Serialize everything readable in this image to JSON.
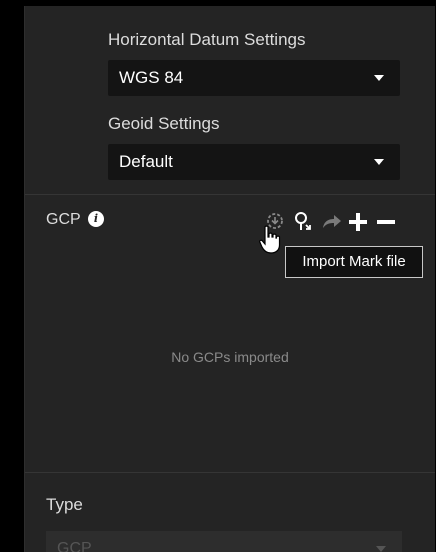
{
  "horizontal_datum": {
    "label": "Horizontal Datum Settings",
    "selected": "WGS 84"
  },
  "geoid": {
    "label": "Geoid Settings",
    "selected": "Default"
  },
  "gcp": {
    "label": "GCP",
    "info_icon": "info-icon",
    "tools": [
      "import-mark-file-icon",
      "locate-icon",
      "redo-icon",
      "add-icon",
      "remove-icon"
    ],
    "tooltip": "Import Mark file",
    "empty_message": "No GCPs imported"
  },
  "type": {
    "label": "Type",
    "selected": "GCP"
  },
  "colors": {
    "page_bg": "#000000",
    "panel_bg": "#242424",
    "select_bg": "#141414",
    "text": "#dcdcdc",
    "muted_text": "#8a8a8a",
    "disabled_icon": "#7a7a7a"
  }
}
